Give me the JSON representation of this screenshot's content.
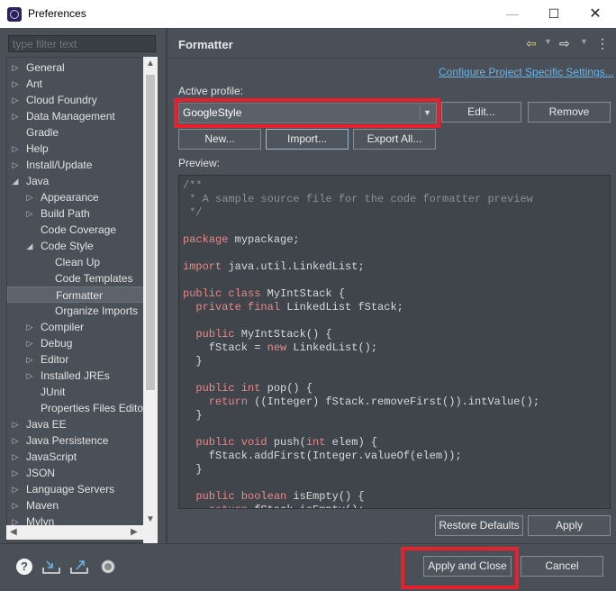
{
  "window": {
    "title": "Preferences",
    "minimize_glyph": "—",
    "maximize_glyph": "☐",
    "close_glyph": "✕"
  },
  "filter": {
    "placeholder": "type filter text"
  },
  "tree": [
    {
      "label": "General",
      "depth": 0,
      "toggle": "collapsed"
    },
    {
      "label": "Ant",
      "depth": 0,
      "toggle": "collapsed"
    },
    {
      "label": "Cloud Foundry",
      "depth": 0,
      "toggle": "collapsed"
    },
    {
      "label": "Data Management",
      "depth": 0,
      "toggle": "collapsed"
    },
    {
      "label": "Gradle",
      "depth": 0,
      "toggle": "none"
    },
    {
      "label": "Help",
      "depth": 0,
      "toggle": "collapsed"
    },
    {
      "label": "Install/Update",
      "depth": 0,
      "toggle": "collapsed"
    },
    {
      "label": "Java",
      "depth": 0,
      "toggle": "expanded"
    },
    {
      "label": "Appearance",
      "depth": 1,
      "toggle": "collapsed"
    },
    {
      "label": "Build Path",
      "depth": 1,
      "toggle": "collapsed"
    },
    {
      "label": "Code Coverage",
      "depth": 1,
      "toggle": "none"
    },
    {
      "label": "Code Style",
      "depth": 1,
      "toggle": "expanded"
    },
    {
      "label": "Clean Up",
      "depth": 2,
      "toggle": "none"
    },
    {
      "label": "Code Templates",
      "depth": 2,
      "toggle": "none"
    },
    {
      "label": "Formatter",
      "depth": 2,
      "toggle": "none",
      "selected": true
    },
    {
      "label": "Organize Imports",
      "depth": 2,
      "toggle": "none"
    },
    {
      "label": "Compiler",
      "depth": 1,
      "toggle": "collapsed"
    },
    {
      "label": "Debug",
      "depth": 1,
      "toggle": "collapsed"
    },
    {
      "label": "Editor",
      "depth": 1,
      "toggle": "collapsed"
    },
    {
      "label": "Installed JREs",
      "depth": 1,
      "toggle": "collapsed"
    },
    {
      "label": "JUnit",
      "depth": 1,
      "toggle": "none"
    },
    {
      "label": "Properties Files Editor",
      "depth": 1,
      "toggle": "none"
    },
    {
      "label": "Java EE",
      "depth": 0,
      "toggle": "collapsed"
    },
    {
      "label": "Java Persistence",
      "depth": 0,
      "toggle": "collapsed"
    },
    {
      "label": "JavaScript",
      "depth": 0,
      "toggle": "collapsed"
    },
    {
      "label": "JSON",
      "depth": 0,
      "toggle": "collapsed"
    },
    {
      "label": "Language Servers",
      "depth": 0,
      "toggle": "collapsed"
    },
    {
      "label": "Maven",
      "depth": 0,
      "toggle": "collapsed"
    },
    {
      "label": "Mylyn",
      "depth": 0,
      "toggle": "collapsed"
    }
  ],
  "page": {
    "title": "Formatter",
    "configure_link": "Configure Project Specific Settings...",
    "active_profile_label": "Active profile:",
    "profile_value": "GoogleStyle",
    "buttons": {
      "edit": "Edit...",
      "remove": "Remove",
      "new": "New...",
      "import": "Import...",
      "export_all": "Export All...",
      "restore_defaults": "Restore Defaults",
      "apply": "Apply"
    },
    "preview_label": "Preview:"
  },
  "preview_code": [
    [
      {
        "t": "/**",
        "c": "cm"
      }
    ],
    [
      {
        "t": " * A sample source file for the code formatter preview",
        "c": "cm"
      }
    ],
    [
      {
        "t": " */",
        "c": "cm"
      }
    ],
    [],
    [
      {
        "t": "package",
        "c": "kw"
      },
      {
        "t": " mypackage;",
        "c": ""
      }
    ],
    [],
    [
      {
        "t": "import",
        "c": "kw"
      },
      {
        "t": " java.util.LinkedList;",
        "c": ""
      }
    ],
    [],
    [
      {
        "t": "public class",
        "c": "kw"
      },
      {
        "t": " MyIntStack {",
        "c": ""
      }
    ],
    [
      {
        "t": "  private final",
        "c": "kw"
      },
      {
        "t": " LinkedList fStack;",
        "c": ""
      }
    ],
    [],
    [
      {
        "t": "  public",
        "c": "kw"
      },
      {
        "t": " MyIntStack() {",
        "c": ""
      }
    ],
    [
      {
        "t": "    fStack = ",
        "c": ""
      },
      {
        "t": "new",
        "c": "kw"
      },
      {
        "t": " LinkedList();",
        "c": ""
      }
    ],
    [
      {
        "t": "  }",
        "c": ""
      }
    ],
    [],
    [
      {
        "t": "  public int",
        "c": "kw"
      },
      {
        "t": " pop() {",
        "c": ""
      }
    ],
    [
      {
        "t": "    return",
        "c": "kw"
      },
      {
        "t": " ((Integer) fStack.removeFirst()).intValue();",
        "c": ""
      }
    ],
    [
      {
        "t": "  }",
        "c": ""
      }
    ],
    [],
    [
      {
        "t": "  public void",
        "c": "kw"
      },
      {
        "t": " push(",
        "c": ""
      },
      {
        "t": "int",
        "c": "kw"
      },
      {
        "t": " elem) {",
        "c": ""
      }
    ],
    [
      {
        "t": "    fStack.addFirst(Integer.valueOf(elem));",
        "c": ""
      }
    ],
    [
      {
        "t": "  }",
        "c": ""
      }
    ],
    [],
    [
      {
        "t": "  public boolean",
        "c": "kw"
      },
      {
        "t": " isEmpty() {",
        "c": ""
      }
    ],
    [
      {
        "t": "    return",
        "c": "kw"
      },
      {
        "t": " fStack.isEmpty();",
        "c": ""
      }
    ]
  ],
  "footer": {
    "apply_close": "Apply and Close",
    "cancel": "Cancel",
    "help_glyph": "?"
  },
  "colors": {
    "highlight_red": "#e8202e",
    "keyword": "#e58a8a",
    "comment": "#8c8f93",
    "link": "#6cb3e6"
  }
}
